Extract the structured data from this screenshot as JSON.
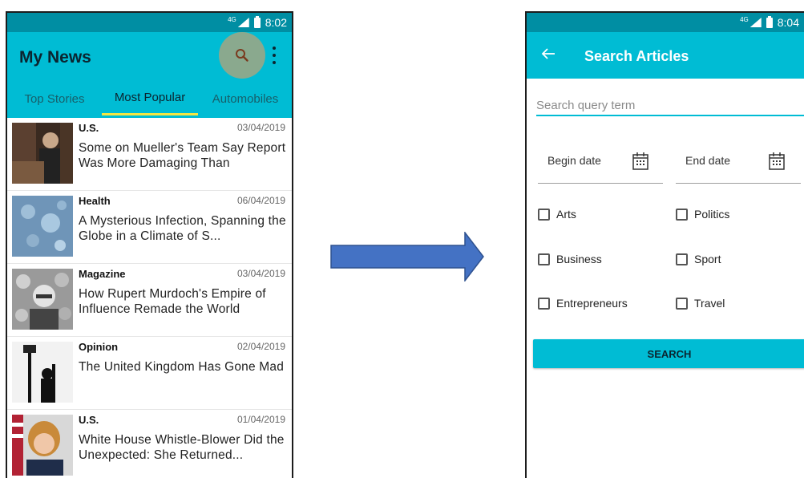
{
  "left_screen": {
    "status": {
      "network": "4G",
      "time": "8:02"
    },
    "title": "My News",
    "tabs": [
      {
        "label": "Top Stories",
        "active": false
      },
      {
        "label": "Most Popular",
        "active": true
      },
      {
        "label": "Automobiles",
        "active": false
      }
    ],
    "articles": [
      {
        "section": "U.S.",
        "date": "03/04/2019",
        "headline": "Some on Mueller's Team Say Report Was More Damaging Than"
      },
      {
        "section": "Health",
        "date": "06/04/2019",
        "headline": "A Mysterious Infection, Spanning the Globe in a Climate of S..."
      },
      {
        "section": "Magazine",
        "date": "03/04/2019",
        "headline": "How Rupert Murdoch's Empire of Influence Remade the World"
      },
      {
        "section": "Opinion",
        "date": "02/04/2019",
        "headline": "The United Kingdom Has Gone Mad"
      },
      {
        "section": "U.S.",
        "date": "01/04/2019",
        "headline": "White House Whistle-Blower Did the Unexpected: She Returned..."
      }
    ]
  },
  "right_screen": {
    "status": {
      "network": "4G",
      "time": "8:04"
    },
    "title": "Search Articles",
    "query_placeholder": "Search query term",
    "begin_date_label": "Begin date",
    "end_date_label": "End date",
    "categories_left": [
      "Arts",
      "Business",
      "Entrepreneurs"
    ],
    "categories_right": [
      "Politics",
      "Sport",
      "Travel"
    ],
    "search_button": "SEARCH"
  },
  "colors": {
    "primary": "#00bcd4",
    "primary_dark": "#008ea3",
    "tab_indicator": "#f5e642",
    "arrow": "#4472c4"
  }
}
